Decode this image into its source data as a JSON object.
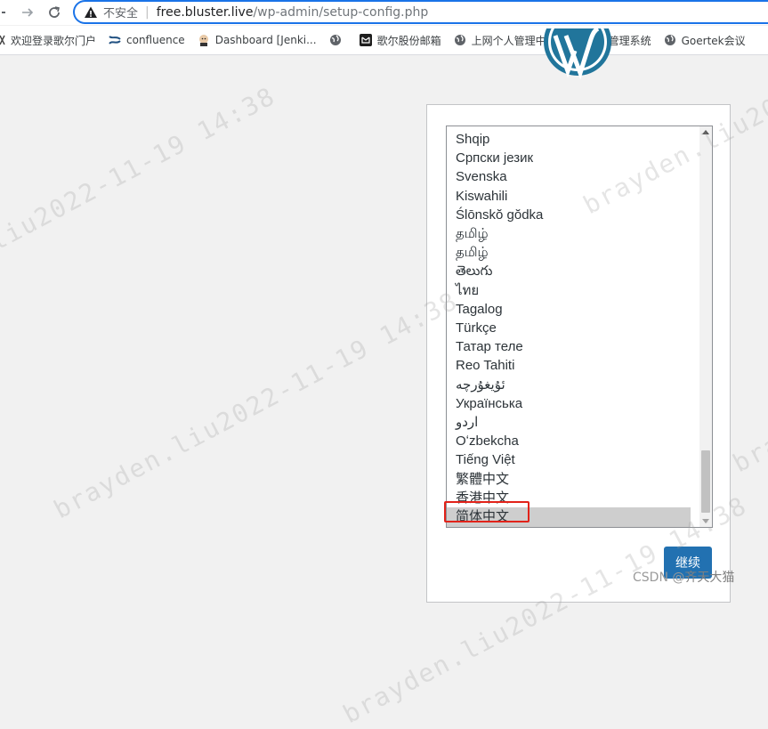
{
  "browser": {
    "security_label": "不安全",
    "url_host": "free.bluster.live",
    "url_path": "/wp-admin/setup-config.php",
    "bookmarks": [
      {
        "label": "欢迎登录歌尔门户",
        "icon": "portal-icon"
      },
      {
        "label": "confluence",
        "icon": "confluence-icon"
      },
      {
        "label": "Dashboard [Jenki...",
        "icon": "jenkins-icon"
      },
      {
        "label": "",
        "icon": "globe-icon"
      },
      {
        "label": "歌尔股份邮箱",
        "icon": "mail-icon"
      },
      {
        "label": "上网个人管理中心",
        "icon": "globe-icon"
      },
      {
        "label": "需求管理系统",
        "icon": "link-icon"
      },
      {
        "label": "Goertek会议",
        "icon": "globe-icon"
      }
    ]
  },
  "setup": {
    "languages": [
      "Shqip",
      "Српски језик",
      "Svenska",
      "Kiswahili",
      "Ślōnskŏ gŏdka",
      "தமிழ்",
      "தமிழ்",
      "తెలుగు",
      "ไทย",
      "Tagalog",
      "Türkçe",
      "Татар теле",
      "Reo Tahiti",
      "ئۇيغۇرچە",
      "Українська",
      "اردو",
      "Oʻzbekcha",
      "Tiếng Việt",
      "繁體中文",
      "香港中文",
      "简体中文"
    ],
    "selected_language": "简体中文",
    "continue_label": "继续"
  },
  "watermark": {
    "text_1": "brayden.liu2022-11-19 14:38",
    "text_2": "brayden.liu2022-11-19 14:38",
    "text_3": "brayden.liu2022-11-19 14:38",
    "text_4": "brayden.liu2022-11-19 14:38",
    "text_5": "brayden.liu2022-11-19 14:38"
  },
  "footer": {
    "source": "CSDN @",
    "author": "齐天大猫"
  },
  "colors": {
    "accent": "#1a73e8",
    "button": "#2271b1",
    "highlight": "#e2231a",
    "wordpress_blue": "#21759b"
  }
}
